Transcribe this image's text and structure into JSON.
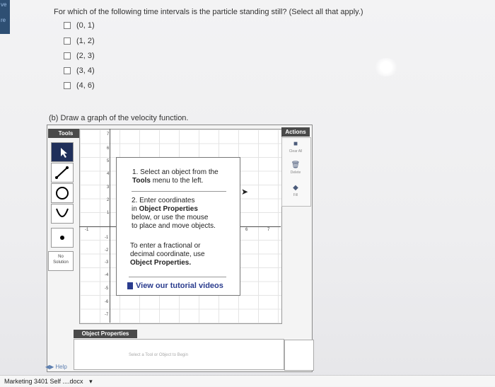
{
  "question": "For which of the following time intervals is the particle standing still? (Select all that apply.)",
  "choices": [
    "(0, 1)",
    "(1, 2)",
    "(2, 3)",
    "(3, 4)",
    "(4, 6)"
  ],
  "part_b": "(b) Draw a graph of the velocity function.",
  "tools": {
    "header": "Tools",
    "items": [
      "pointer-icon",
      "segment-icon",
      "circle-icon",
      "parabola-icon",
      "point-icon"
    ],
    "no_solution": [
      "No",
      "Solution"
    ]
  },
  "graph": {
    "y_ticks": [
      "7",
      "6",
      "5",
      "4",
      "3",
      "2",
      "1",
      "-1",
      "-2",
      "-3",
      "-4",
      "-5",
      "-6",
      "-7"
    ],
    "x_ticks_neg": [
      "-1"
    ],
    "x_ticks_pos": [
      "6",
      "7"
    ]
  },
  "popup": {
    "step1_a": "1. Select an object from the",
    "step1_b": "Tools",
    "step1_c": " menu to the left.",
    "step2_a": "2. Enter coordinates",
    "step2_b": "in ",
    "step2_c": "Object Properties",
    "step2_d": "below, or use the mouse",
    "step2_e": "to place and move objects.",
    "tip_a": "To enter a fractional or",
    "tip_b": "decimal coordinate, use",
    "tip_c": "Object Properties.",
    "tutorial": "View our tutorial videos"
  },
  "actions": {
    "header": "Actions",
    "clear_all": "Clear All",
    "delete": "Delete",
    "fill": "Fill"
  },
  "object_properties": {
    "header": "Object Properties",
    "hint": "Select a Tool or Object to Begin"
  },
  "help": "Help",
  "taskbar": {
    "file": "Marketing 3401 Self ....docx",
    "arrow": "▾"
  },
  "left_strip": [
    "ve",
    "re"
  ]
}
